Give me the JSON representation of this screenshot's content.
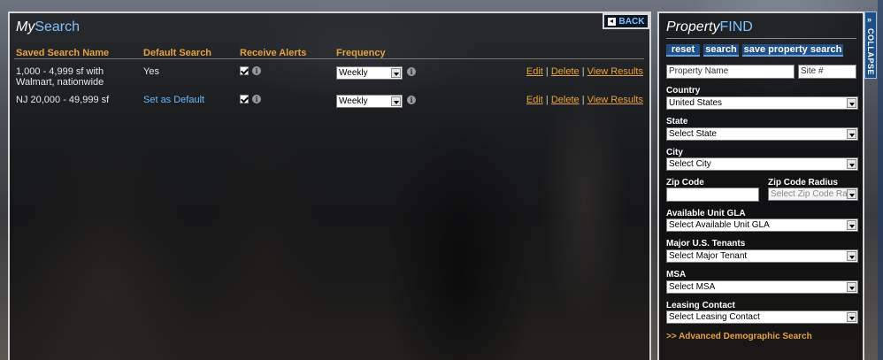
{
  "my_search": {
    "title_my": "My",
    "title_search": "Search",
    "back_label": "BACK",
    "columns": {
      "name": "Saved Search Name",
      "default": "Default Search",
      "alerts": "Receive Alerts",
      "frequency": "Frequency"
    },
    "rows": [
      {
        "name": "1,000 - 4,999 sf with Walmart, nationwide",
        "default": "Yes",
        "alerts_checked": true,
        "frequency": "Weekly",
        "edit": "Edit",
        "delete": "Delete",
        "view": "View Results"
      },
      {
        "name": "NJ 20,000 - 49,999 sf",
        "default": "Set as Default",
        "alerts_checked": true,
        "frequency": "Weekly",
        "edit": "Edit",
        "delete": "Delete",
        "view": "View Results"
      }
    ],
    "separator": "|"
  },
  "property_find": {
    "title_property": "Property",
    "title_find": "FIND",
    "buttons": {
      "reset": "reset",
      "search": "search",
      "save": "save property search"
    },
    "property_name_placeholder": "Property Name",
    "site_placeholder": "Site #",
    "country_label": "Country",
    "country_value": "United States",
    "state_label": "State",
    "state_value": "Select State",
    "city_label": "City",
    "city_value": "Select City",
    "zip_label": "Zip Code",
    "zip_radius_label": "Zip Code Radius",
    "zip_radius_value": "Select Zip Code Rad",
    "gla_label": "Available Unit GLA",
    "gla_value": "Select Available Unit GLA",
    "tenants_label": "Major U.S. Tenants",
    "tenants_value": "Select Major Tenant",
    "msa_label": "MSA",
    "msa_value": "Select MSA",
    "leasing_label": "Leasing Contact",
    "leasing_value": "Select Leasing Contact",
    "advanced_link": ">> Advanced Demographic Search"
  },
  "collapse_label": "COLLAPSE",
  "colors": {
    "accent_orange": "#e9a13b",
    "accent_blue": "#7ec3ff",
    "button_blue": "#1e4f86"
  }
}
